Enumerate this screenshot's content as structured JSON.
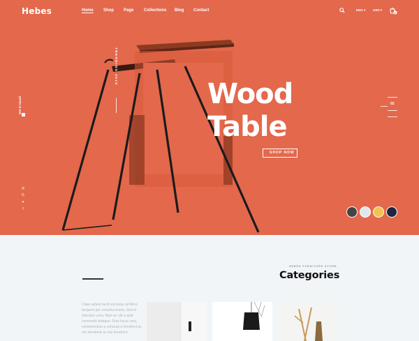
{
  "header": {
    "logo": "Hebes",
    "nav": [
      {
        "label": "Home",
        "active": true
      },
      {
        "label": "Shop",
        "active": false
      },
      {
        "label": "Page",
        "active": false
      },
      {
        "label": "Collections",
        "active": false
      },
      {
        "label": "Blog",
        "active": false
      },
      {
        "label": "Contact",
        "active": false
      }
    ],
    "language": "ENG",
    "currency": "USD",
    "cart_count": "0"
  },
  "hero": {
    "side_link": "Get in touch",
    "vertical_tag": "TRENDING 2018",
    "headline_line1": "Wood",
    "headline_line2": "Table",
    "cta": "SHOP NOW",
    "slide_number": "02",
    "social_icons": [
      "instagram-icon",
      "google-plus-icon",
      "twitter-icon",
      "facebook-icon"
    ],
    "color": "#e3684c"
  },
  "categories": {
    "eyebrow": "HEBES FURNITURE STORE",
    "title": "Categories",
    "description": "Class aptent taciti sociosqu ad litora torquent per conubia nostra, Sed id interdum urna. Nam ac elit a ante commodo tristique. Duis lacus urna, condimentum a vehicula a hendrerit ac nisi hendrerit ac nisi hendrerit"
  }
}
